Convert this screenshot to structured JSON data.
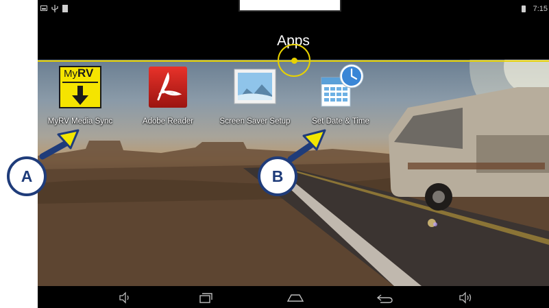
{
  "status_bar": {
    "time": "7:15",
    "left_icons": [
      "image-icon",
      "usb-icon",
      "sd-card-icon"
    ],
    "battery_icon": "battery-icon"
  },
  "header": {
    "title": "Apps",
    "accent_color": "#e8d200"
  },
  "apps": [
    {
      "label": "MyRV Media Sync",
      "icon": "myrv-media-sync-icon",
      "icon_text_my": "My",
      "icon_text_rv": "RV"
    },
    {
      "label": "Adobe Reader",
      "icon": "adobe-reader-icon"
    },
    {
      "label": "Screen Saver Setup",
      "icon": "screen-saver-icon"
    },
    {
      "label": "Set Date & Time",
      "icon": "calendar-clock-icon"
    }
  ],
  "nav_bar": {
    "buttons": [
      "volume-down-icon",
      "recent-apps-icon",
      "home-icon",
      "back-icon",
      "volume-up-icon"
    ]
  },
  "callouts": {
    "a": "A",
    "b": "B",
    "color": "#1f3c7a",
    "arrow_color": "#f2e600"
  }
}
